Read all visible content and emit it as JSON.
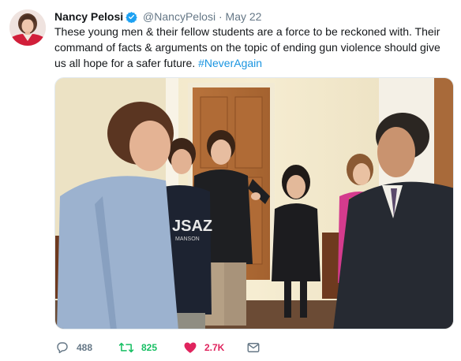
{
  "tweet": {
    "author_name": "Nancy Pelosi",
    "handle": "@NancyPelosi",
    "separator": "·",
    "date": "May 22",
    "text_line1": "These young men & their fellow students are a force to be reckoned with. Their",
    "text_line2": "command of facts & arguments on the topic of ending gun violence should give",
    "text_line3_prefix": "us all hope for a safer future.",
    "hashtag": "#NeverAgain"
  },
  "photo": {
    "shirt_print": "JSAZ",
    "shirt_print_small": "MANSON"
  },
  "actions": {
    "replies": "488",
    "retweets": "825",
    "likes": "2.7K"
  },
  "colors": {
    "text": "#14171a",
    "secondary": "#657786",
    "link": "#1b95e0",
    "retweet_active": "#17bf63",
    "like_active": "#e0245e",
    "verified": "#1da1f2"
  },
  "icons": {
    "verified": "verified-badge-icon",
    "reply": "reply-icon",
    "retweet": "retweet-icon",
    "like": "heart-icon",
    "dm": "envelope-icon"
  }
}
